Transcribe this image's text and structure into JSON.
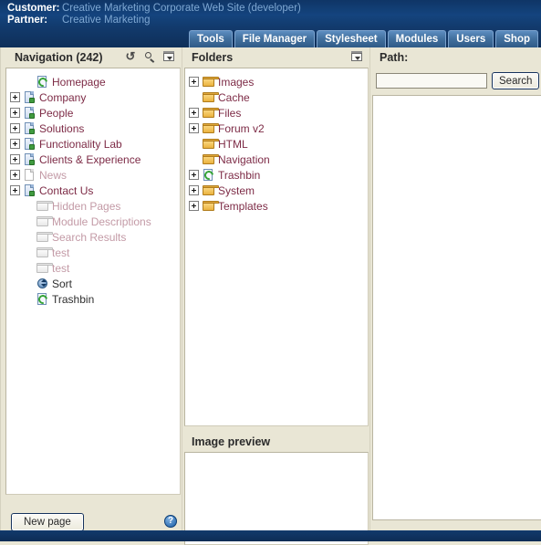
{
  "header": {
    "customer_label": "Customer:",
    "customer_value": "Creative Marketing Corporate Web Site (developer)",
    "partner_label": "Partner:",
    "partner_value": "Creative Marketing"
  },
  "tabs": [
    {
      "label": "Tools"
    },
    {
      "label": "File Manager"
    },
    {
      "label": "Stylesheet"
    },
    {
      "label": "Modules"
    },
    {
      "label": "Users"
    },
    {
      "label": "Shop"
    }
  ],
  "navigation": {
    "title": "Navigation (242)",
    "icons": [
      "refresh-icon",
      "search-icon",
      "collapse-icon"
    ],
    "new_page_label": "New page",
    "help_label": "?",
    "items": [
      {
        "label": "Homepage",
        "icon": "homepage-icon",
        "expander": false,
        "state": "normal",
        "indent": 1
      },
      {
        "label": "Company",
        "icon": "page-icon",
        "expander": true,
        "state": "normal",
        "indent": 0
      },
      {
        "label": "People",
        "icon": "page-icon",
        "expander": true,
        "state": "normal",
        "indent": 0
      },
      {
        "label": "Solutions",
        "icon": "page-icon",
        "expander": true,
        "state": "normal",
        "indent": 0
      },
      {
        "label": "Functionality Lab",
        "icon": "page-icon",
        "expander": true,
        "state": "normal",
        "indent": 0
      },
      {
        "label": "Clients & Experience",
        "icon": "page-icon",
        "expander": true,
        "state": "normal",
        "indent": 0
      },
      {
        "label": "News",
        "icon": "page-plain-icon",
        "expander": true,
        "state": "dim",
        "indent": 0
      },
      {
        "label": "Contact Us",
        "icon": "page-icon",
        "expander": true,
        "state": "normal",
        "indent": 0
      },
      {
        "label": "Hidden Pages",
        "icon": "folder-gray-icon",
        "expander": false,
        "state": "dim",
        "indent": 1
      },
      {
        "label": "Module Descriptions",
        "icon": "folder-gray-icon",
        "expander": false,
        "state": "dim",
        "indent": 1
      },
      {
        "label": "Search Results",
        "icon": "folder-gray-icon",
        "expander": false,
        "state": "dim",
        "indent": 1
      },
      {
        "label": "test",
        "icon": "folder-gray-icon",
        "expander": false,
        "state": "dim",
        "indent": 1
      },
      {
        "label": "test",
        "icon": "folder-gray-icon",
        "expander": false,
        "state": "dim",
        "indent": 1
      },
      {
        "label": "Sort",
        "icon": "sort-icon",
        "expander": false,
        "state": "dark",
        "indent": 1
      },
      {
        "label": "Trashbin",
        "icon": "trashbin-icon",
        "expander": false,
        "state": "dark",
        "indent": 1
      }
    ]
  },
  "folders": {
    "title": "Folders",
    "icons": [
      "collapse-icon"
    ],
    "items": [
      {
        "label": "Images",
        "icon": "folder-icon",
        "expander": true,
        "indent": 0
      },
      {
        "label": "Cache",
        "icon": "folder-icon",
        "expander": false,
        "indent": 0
      },
      {
        "label": "Files",
        "icon": "folder-icon",
        "expander": true,
        "indent": 0
      },
      {
        "label": "Forum v2",
        "icon": "folder-icon",
        "expander": true,
        "indent": 0
      },
      {
        "label": "HTML",
        "icon": "folder-icon",
        "expander": false,
        "indent": 0
      },
      {
        "label": "Navigation",
        "icon": "folder-icon",
        "expander": false,
        "indent": 0
      },
      {
        "label": "Trashbin",
        "icon": "trashbin-icon",
        "expander": true,
        "indent": 0
      },
      {
        "label": "System",
        "icon": "folder-icon",
        "expander": true,
        "indent": 0
      },
      {
        "label": "Templates",
        "icon": "folder-icon",
        "expander": true,
        "indent": 0
      }
    ]
  },
  "preview": {
    "title": "Image preview"
  },
  "right": {
    "path_label": "Path:",
    "search_value": "",
    "search_placeholder": "",
    "search_button_label": "Search"
  },
  "colors": {
    "header_navy": "#123a6c",
    "panel_cream": "#e9e6d5",
    "link_maroon": "#7d2b46",
    "link_dim": "#c39aa6",
    "header_value_blue": "#7ea7d2"
  }
}
